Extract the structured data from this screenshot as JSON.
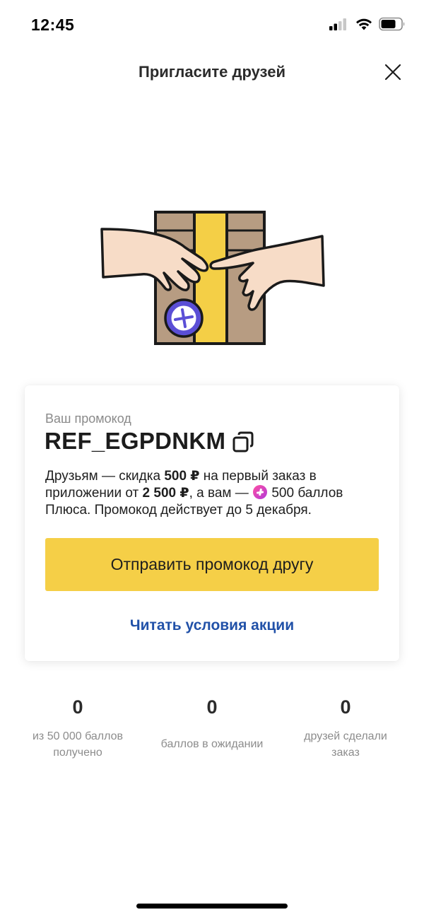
{
  "status_bar": {
    "time": "12:45"
  },
  "header": {
    "title": "Пригласите друзей",
    "close_icon": "close-icon"
  },
  "promo": {
    "label": "Ваш промокод",
    "code": "REF_EGPDNKM",
    "description": {
      "part1": "Друзьям — скидка ",
      "discount": "500 ₽",
      "part2": " на первый заказ в приложении от ",
      "min_order": "2 500 ₽",
      "part3": ", а вам — ",
      "bonus": "500 баллов Плюса. Промокод действует до 5 декабря."
    },
    "send_button": "Отправить промокод другу",
    "terms_link": "Читать условия акции"
  },
  "stats": [
    {
      "value": "0",
      "label": "из 50 000 баллов получено"
    },
    {
      "value": "0",
      "label": "баллов в ожидании"
    },
    {
      "value": "0",
      "label": "друзей сделали заказ"
    }
  ],
  "colors": {
    "accent_yellow": "#f5cf47",
    "link_blue": "#2151a8",
    "plus_gradient_start": "#ff4fa3",
    "plus_gradient_end": "#b23ad8",
    "muted_text": "#8c8c8c"
  }
}
